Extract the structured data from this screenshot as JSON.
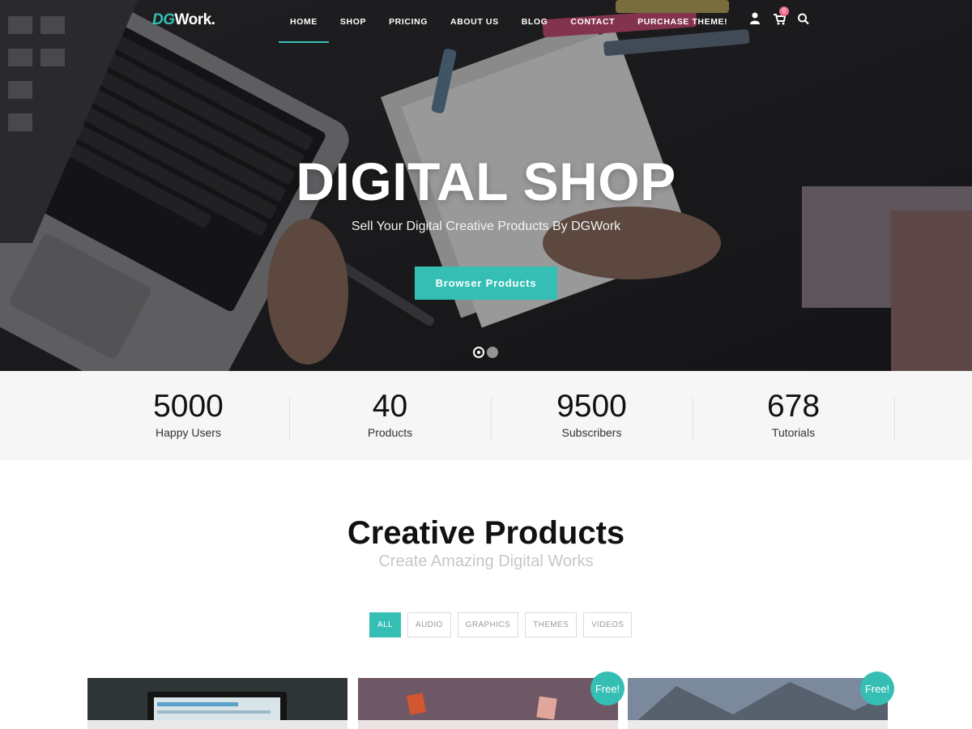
{
  "brand": {
    "logo_prefix": "DG",
    "logo_suffix": "Work.",
    "accent_color": "#35bfb4"
  },
  "nav": {
    "items": [
      {
        "label": "HOME",
        "active": true
      },
      {
        "label": "SHOP",
        "active": false
      },
      {
        "label": "PRICING",
        "active": false
      },
      {
        "label": "ABOUT US",
        "active": false
      },
      {
        "label": "BLOG",
        "active": false
      },
      {
        "label": "CONTACT",
        "active": false
      },
      {
        "label": "PURCHASE THEME!",
        "active": false
      }
    ],
    "icons": [
      "user-icon",
      "cart-icon",
      "search-icon"
    ],
    "cart_count": "0"
  },
  "hero": {
    "title": "DIGITAL SHOP",
    "subtitle": "Sell Your Digital Creative Products By DGWork",
    "button_label": "Browser Products",
    "slides_total": 2,
    "slide_active": 1
  },
  "stats": [
    {
      "value": "5000",
      "label": "Happy Users"
    },
    {
      "value": "40",
      "label": "Products"
    },
    {
      "value": "9500",
      "label": "Subscribers"
    },
    {
      "value": "678",
      "label": "Tutorials"
    }
  ],
  "products": {
    "title": "Creative Products",
    "subtitle": "Create Amazing Digital Works",
    "filters": [
      {
        "label": "ALL",
        "active": true
      },
      {
        "label": "AUDIO",
        "active": false
      },
      {
        "label": "GRAPHICS",
        "active": false
      },
      {
        "label": "THEMES",
        "active": false
      },
      {
        "label": "VIDEOS",
        "active": false
      }
    ],
    "cards": [
      {
        "badge": ""
      },
      {
        "badge": "Free!"
      },
      {
        "badge": "Free!"
      }
    ]
  }
}
